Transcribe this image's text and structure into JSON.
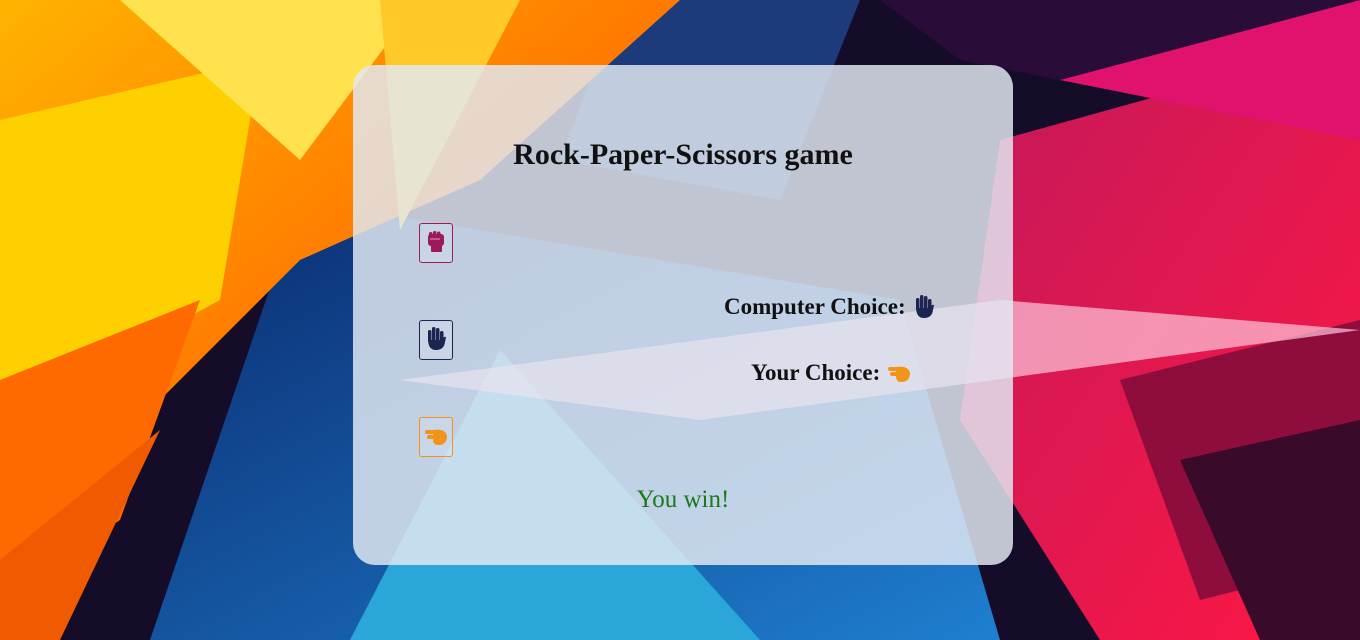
{
  "title": "Rock-Paper-Scissors game",
  "choices": [
    {
      "name": "rock",
      "icon": "fist-icon",
      "color": "#9c1a5b"
    },
    {
      "name": "paper",
      "icon": "raised-hand-icon",
      "color": "#1b2550"
    },
    {
      "name": "scissors",
      "icon": "pointing-hand-icon",
      "color": "#f2931a"
    }
  ],
  "computer_choice": {
    "label": "Computer Choice:",
    "icon": "raised-hand-icon"
  },
  "your_choice": {
    "label": "Your Choice:",
    "icon": "pointing-hand-icon"
  },
  "outcome": {
    "text": "You win!",
    "color": "#1a7a1a"
  }
}
